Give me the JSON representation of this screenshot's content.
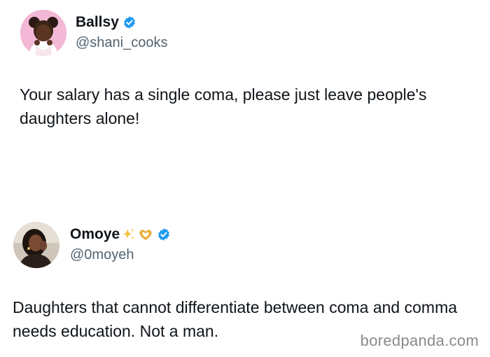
{
  "tweets": [
    {
      "display_name": "Ballsy",
      "handle": "@shani_cooks",
      "text": "Your salary has a single coma, please just leave people's daughters alone!",
      "verified": true,
      "verified_color": "#1d9bf0"
    },
    {
      "display_name": "Omoye",
      "handle": "@0moyeh",
      "text": "Daughters that cannot differentiate between coma and comma needs education. Not a man.",
      "emojis": [
        "sparkles-emoji",
        "heart-hands-emoji"
      ],
      "verified": true,
      "verified_color": "#1d9bf0"
    }
  ],
  "watermark": "boredpanda.com"
}
